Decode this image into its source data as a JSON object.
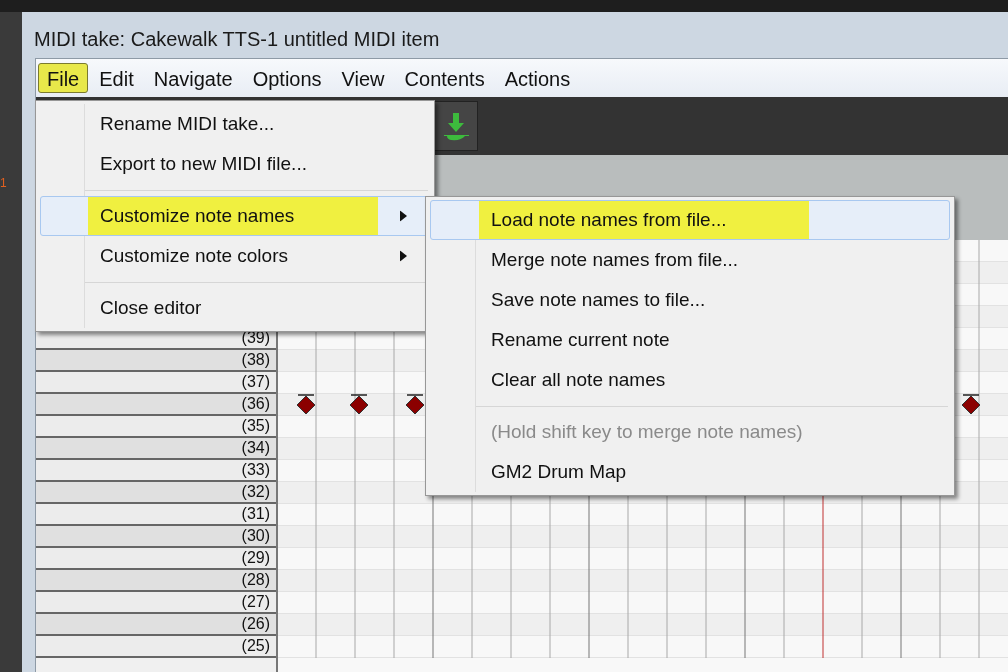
{
  "window": {
    "title": "MIDI take: Cakewalk TTS-1 untitled MIDI item"
  },
  "left_panel": {
    "text": "1"
  },
  "menu_bar": [
    {
      "label": "File",
      "selected": true
    },
    {
      "label": "Edit",
      "selected": false
    },
    {
      "label": "Navigate",
      "selected": false
    },
    {
      "label": "Options",
      "selected": false
    },
    {
      "label": "View",
      "selected": false
    },
    {
      "label": "Contents",
      "selected": false
    },
    {
      "label": "Actions",
      "selected": false
    }
  ],
  "file_menu": [
    {
      "kind": "item",
      "label": "Rename MIDI take...",
      "selected": false
    },
    {
      "kind": "item",
      "label": "Export to new MIDI file...",
      "selected": false
    },
    {
      "kind": "separator"
    },
    {
      "kind": "submenu",
      "label": "Customize note names",
      "selected": true
    },
    {
      "kind": "submenu",
      "label": "Customize note colors",
      "selected": false
    },
    {
      "kind": "separator"
    },
    {
      "kind": "item",
      "label": "Close editor",
      "selected": false
    }
  ],
  "submenu": [
    {
      "kind": "item",
      "label": "Load note names from file...",
      "selected": true,
      "disabled": false
    },
    {
      "kind": "item",
      "label": "Merge note names from file...",
      "selected": false,
      "disabled": false
    },
    {
      "kind": "item",
      "label": "Save note names to file...",
      "selected": false,
      "disabled": false
    },
    {
      "kind": "item",
      "label": "Rename current note",
      "selected": false,
      "disabled": false
    },
    {
      "kind": "item",
      "label": "Clear all note names",
      "selected": false,
      "disabled": false
    },
    {
      "kind": "separator"
    },
    {
      "kind": "item",
      "label": "(Hold shift key to merge note names)",
      "selected": false,
      "disabled": true
    },
    {
      "kind": "item",
      "label": "GM2 Drum Map",
      "selected": false,
      "disabled": false
    }
  ],
  "piano_roll": {
    "keys": [
      "(39)",
      "(38)",
      "(37)",
      "(36)",
      "(35)",
      "(34)",
      "(33)",
      "(32)",
      "(31)",
      "(30)",
      "(29)",
      "(28)",
      "(27)",
      "(26)",
      "(25)"
    ]
  }
}
